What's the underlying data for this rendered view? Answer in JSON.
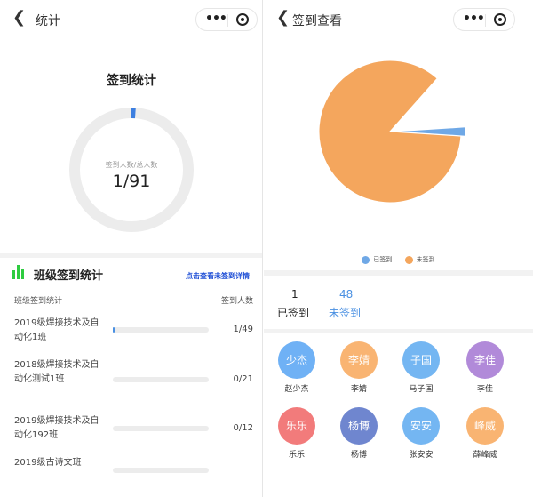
{
  "left": {
    "nav_title": "统计",
    "stats_title": "签到统计",
    "ring_caption": "签到人数/总人数",
    "ring_value": "1/91",
    "ring_fraction": 0.011,
    "section_title": "班级签到统计",
    "detail_link": "点击查看未签到详情",
    "table_header": {
      "left": "班级签到统计",
      "right": "签到人数"
    },
    "rows": [
      {
        "class": "2019级焊接技术及自动化1班",
        "count": "1/49",
        "fraction": 0.0204
      },
      {
        "class": "2018级焊接技术及自动化测试1班",
        "count": "0/21",
        "fraction": 0
      },
      {
        "class": "2019级焊接技术及自动化192班",
        "count": "0/12",
        "fraction": 0
      },
      {
        "class": "2019级古诗文班",
        "count": "",
        "fraction": 0
      }
    ]
  },
  "right": {
    "nav_title": "签到查看",
    "legend": [
      {
        "label": "已签到",
        "color": "#6fa8e6"
      },
      {
        "label": "未签到",
        "color": "#f4a65d"
      }
    ],
    "signed_count": "1",
    "signed_label": "已签到",
    "unsigned_count": "48",
    "unsigned_label": "未签到",
    "people": [
      {
        "avatar": "少杰",
        "name": "赵少杰",
        "color": "#6fb1f5"
      },
      {
        "avatar": "李婧",
        "name": "李婧",
        "color": "#f9b472"
      },
      {
        "avatar": "子国",
        "name": "马子国",
        "color": "#74b6f2"
      },
      {
        "avatar": "李佳",
        "name": "李佳",
        "color": "#b18ad9"
      },
      {
        "avatar": "乐乐",
        "name": "乐乐",
        "color": "#f27b7b"
      },
      {
        "avatar": "杨博",
        "name": "杨博",
        "color": "#6f86cf"
      },
      {
        "avatar": "安安",
        "name": "张安安",
        "color": "#74b6f2"
      },
      {
        "avatar": "峰威",
        "name": "薛峰威",
        "color": "#f9b472"
      }
    ]
  },
  "chart_data": {
    "type": "pie",
    "categories": [
      "已签到",
      "未签到"
    ],
    "values": [
      1,
      48
    ],
    "legend_position": "bottom"
  }
}
